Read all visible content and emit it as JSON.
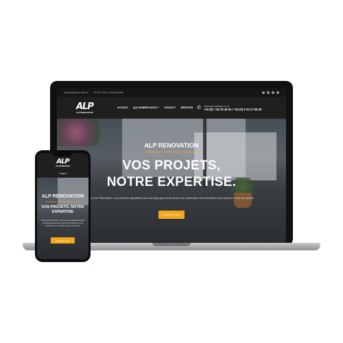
{
  "site": {
    "topbar": {
      "email": "contact@alprenovation.fr",
      "address": "35 Rue Rovis, 13006 Marseille"
    },
    "logo": {
      "mark": "ALP",
      "subtitle": "ALP RENOVATION"
    },
    "nav": [
      "ACCUEIL",
      "QUI SOMMES-NOUS ?",
      "CONTACT",
      "SERVICES"
    ],
    "phone": {
      "label": "PRENDRE RENDEZ-VOUS",
      "numbers": "+33 (0) 7 53 78 49 92 / +33 (0) 6 33 17 66 28"
    },
    "hero": {
      "brand": "ALP RENOVATION",
      "tagline": "Construction - Revêtements - Rénovation",
      "title_line1": "VOS PROJETS,",
      "title_line2": "NOTRE EXPERTISE.",
      "description": "Chez ALP Rénovation, nous sommes spécialisés dans une large gamme de services de construction et de rénovation pour répondre à tous vos besoins.",
      "cta": "Contactez-nous"
    }
  },
  "mobile": {
    "menu_label": "☰ MENU",
    "title_line1": "VOS PROJETS, NOTRE",
    "title_line2": "EXPERTISE"
  },
  "colors": {
    "accent": "#f3a81c",
    "header_bg": "#1f1f1f",
    "topbar_bg": "#161616"
  }
}
